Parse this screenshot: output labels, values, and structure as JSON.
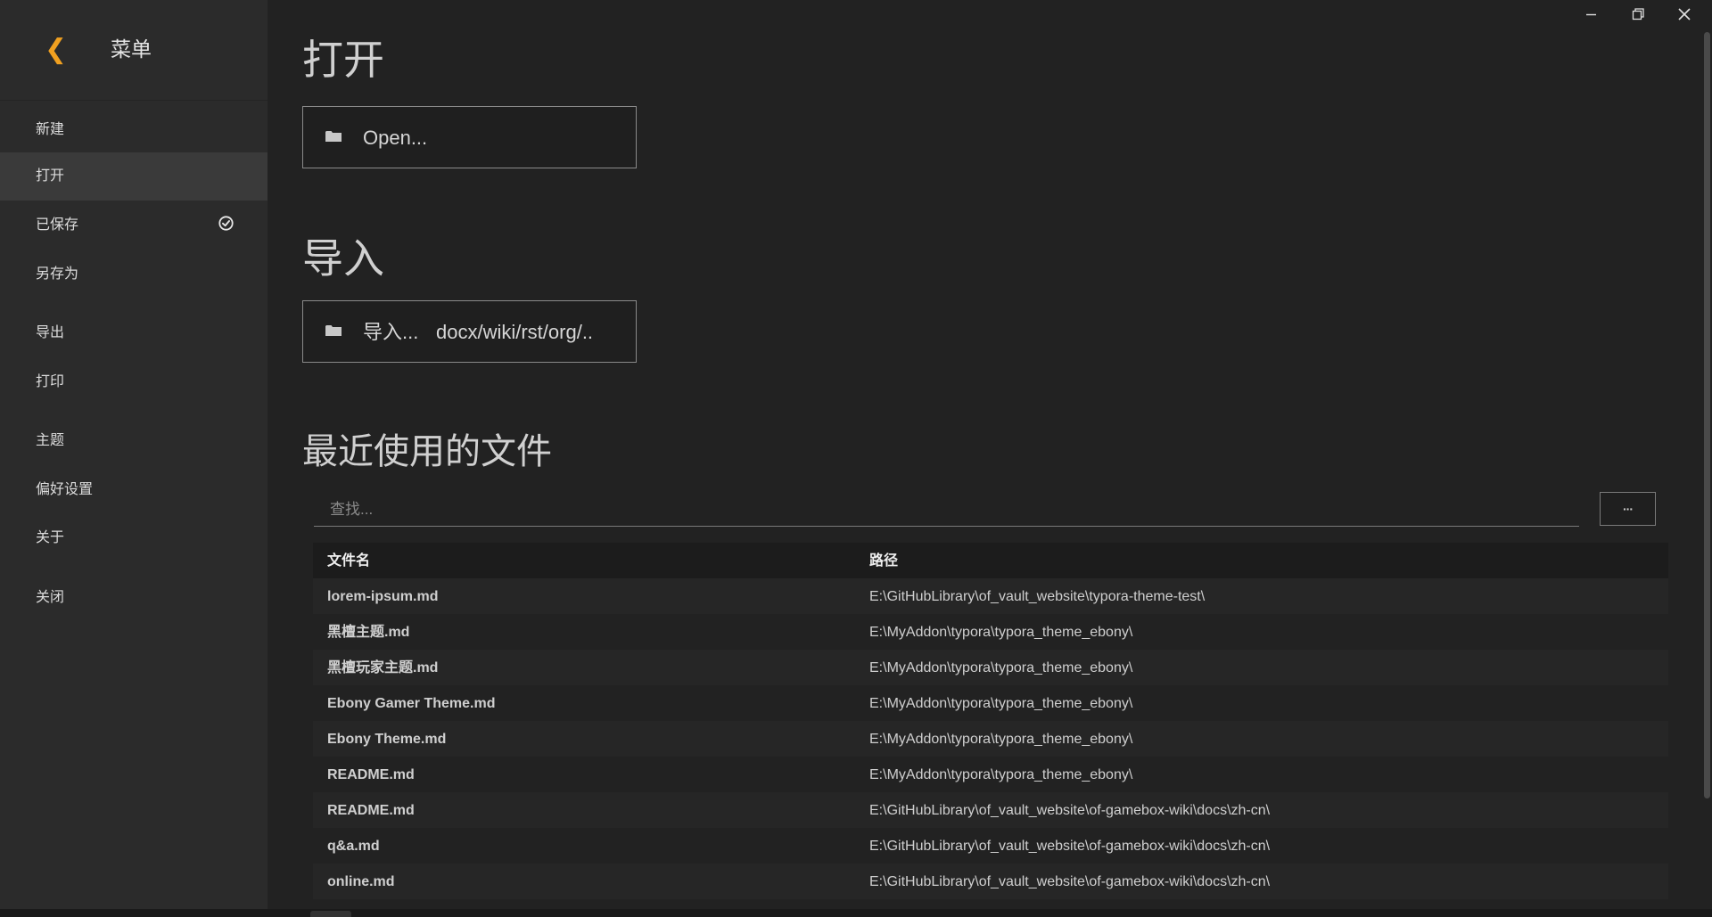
{
  "sidebar": {
    "title": "菜单",
    "items": [
      {
        "label": "新建"
      },
      {
        "label": "打开"
      },
      {
        "label": "已保存"
      },
      {
        "label": "另存为"
      },
      {
        "label": "导出"
      },
      {
        "label": "打印"
      },
      {
        "label": "主题"
      },
      {
        "label": "偏好设置"
      },
      {
        "label": "关于"
      },
      {
        "label": "关闭"
      }
    ],
    "active": "打开"
  },
  "main": {
    "open_title": "打开",
    "open_button": "Open...",
    "import_title": "导入",
    "import_button": "导入...",
    "import_formats": "docx/wiki/rst/org/..",
    "recent_title": "最近使用的文件",
    "search_placeholder": "查找...",
    "more_button": "···"
  },
  "table": {
    "headers": {
      "name": "文件名",
      "path": "路径"
    },
    "rows": [
      {
        "name": "lorem-ipsum.md",
        "path": "E:\\GitHubLibrary\\of_vault_website\\typora-theme-test\\"
      },
      {
        "name": "黑檀主题.md",
        "path": "E:\\MyAddon\\typora\\typora_theme_ebony\\"
      },
      {
        "name": "黑檀玩家主题.md",
        "path": "E:\\MyAddon\\typora\\typora_theme_ebony\\"
      },
      {
        "name": "Ebony Gamer Theme.md",
        "path": "E:\\MyAddon\\typora\\typora_theme_ebony\\"
      },
      {
        "name": "Ebony Theme.md",
        "path": "E:\\MyAddon\\typora\\typora_theme_ebony\\"
      },
      {
        "name": "README.md",
        "path": "E:\\MyAddon\\typora\\typora_theme_ebony\\"
      },
      {
        "name": "README.md",
        "path": "E:\\GitHubLibrary\\of_vault_website\\of-gamebox-wiki\\docs\\zh-cn\\"
      },
      {
        "name": "q&a.md",
        "path": "E:\\GitHubLibrary\\of_vault_website\\of-gamebox-wiki\\docs\\zh-cn\\"
      },
      {
        "name": "online.md",
        "path": "E:\\GitHubLibrary\\of_vault_website\\of-gamebox-wiki\\docs\\zh-cn\\"
      }
    ]
  },
  "icons": {
    "back": "chevron-left-icon",
    "saved": "check-circle-icon",
    "folder": "folder-icon",
    "minimize": "minimize-icon",
    "restore": "restore-icon",
    "close": "close-icon"
  },
  "colors": {
    "accent": "#f0a020",
    "sidebar_bg": "#2b2b2b",
    "main_bg": "#222222",
    "active_item_bg": "#3a3a3a"
  }
}
